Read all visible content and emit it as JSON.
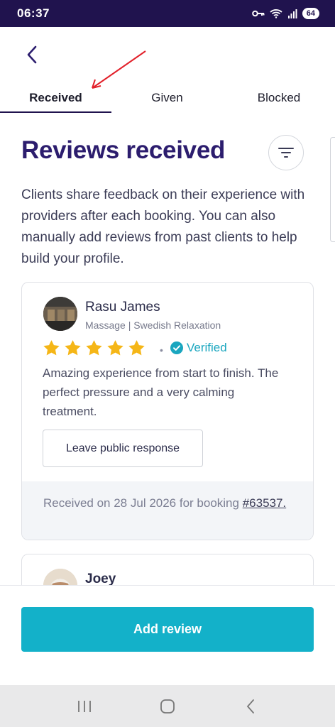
{
  "status_bar": {
    "time": "06:37",
    "battery": "64"
  },
  "tabs": [
    {
      "label": "Received",
      "active": true
    },
    {
      "label": "Given",
      "active": false
    },
    {
      "label": "Blocked",
      "active": false
    }
  ],
  "page": {
    "title": "Reviews received",
    "intro": "Clients share feedback on their experience with providers after each booking. You can also manually add reviews from past clients to help build your profile."
  },
  "reviews": [
    {
      "name": "Rasu James",
      "service": "Massage | Swedish Relaxation",
      "rating": 5,
      "separator": "•",
      "verified_label": "Verified",
      "text": "Amazing experience from start to finish. The perfect pressure and a very calming treatment.",
      "response_button": "Leave public response",
      "footer_text": "Received on 28 Jul 2026 for booking ",
      "booking_ref": "#63537."
    },
    {
      "name": "Joey"
    }
  ],
  "actions": {
    "add_review": "Add review"
  },
  "colors": {
    "brand": "#2c1d6e",
    "accent": "#13b1c9",
    "star": "#f5b617",
    "verified": "#1aa6bf",
    "status_bar": "#20134e"
  },
  "icons": {
    "back": "chevron-left-icon",
    "filter": "filter-icon",
    "verified": "check-circle-icon",
    "star": "star-icon"
  }
}
